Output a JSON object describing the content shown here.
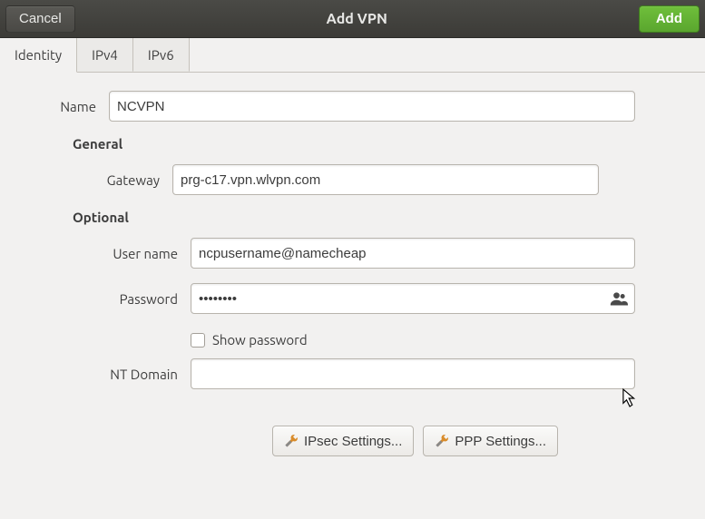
{
  "titlebar": {
    "cancel": "Cancel",
    "title": "Add VPN",
    "add": "Add"
  },
  "tabs": {
    "identity": "Identity",
    "ipv4": "IPv4",
    "ipv6": "IPv6"
  },
  "form": {
    "name_label": "Name",
    "name_value": "NCVPN",
    "general_header": "General",
    "gateway_label": "Gateway",
    "gateway_value": "prg-c17.vpn.wlvpn.com",
    "optional_header": "Optional",
    "username_label": "User name",
    "username_value": "ncpusername@namecheap",
    "password_label": "Password",
    "password_value": "••••••••",
    "show_password_label": "Show password",
    "ntdomain_label": "NT Domain",
    "ntdomain_value": ""
  },
  "buttons": {
    "ipsec": "IPsec Settings...",
    "ppp": "PPP Settings..."
  }
}
